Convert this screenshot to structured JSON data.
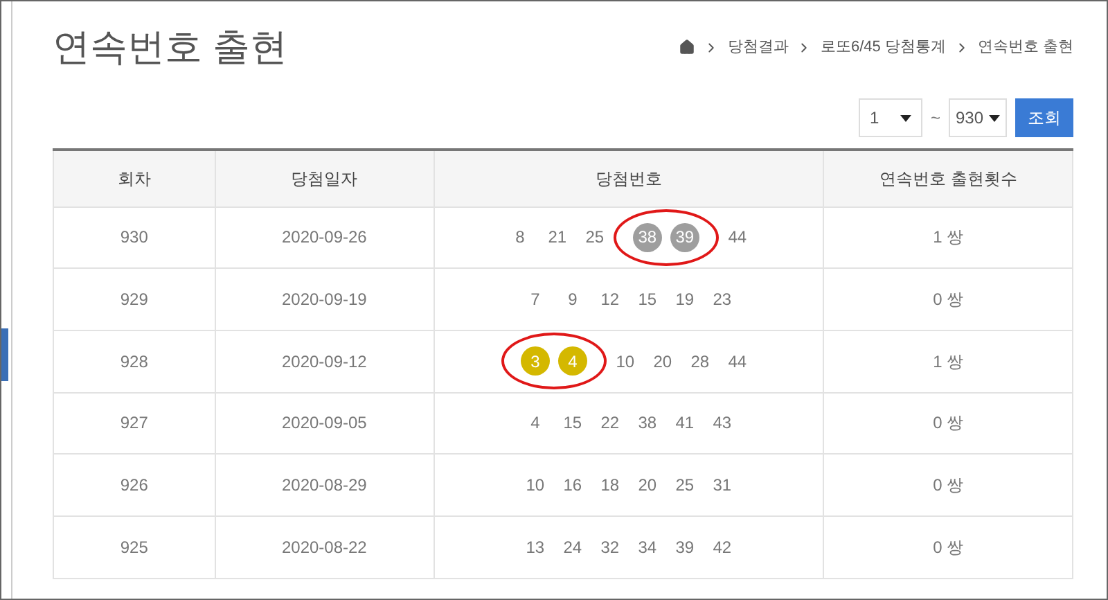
{
  "title": "연속번호 출현",
  "breadcrumb": [
    "당첨결과",
    "로또6/45 당첨통계",
    "연속번호 출현"
  ],
  "range": {
    "from": "1",
    "tilde": "~",
    "to": "930",
    "button": "조회"
  },
  "table": {
    "columns": [
      "회차",
      "당첨일자",
      "당첨번호",
      "연속번호 출현횟수"
    ],
    "rows": [
      {
        "round": "930",
        "date": "2020-09-26",
        "numbers": [
          {
            "n": "8",
            "ball": false
          },
          {
            "n": "21",
            "ball": false
          },
          {
            "n": "25",
            "ball": false
          },
          {
            "n": "38",
            "ball": true,
            "color": "#9e9e9e",
            "circled": true
          },
          {
            "n": "39",
            "ball": true,
            "color": "#9e9e9e",
            "circled": true
          },
          {
            "n": "44",
            "ball": false
          }
        ],
        "count": "1 쌍"
      },
      {
        "round": "929",
        "date": "2020-09-19",
        "numbers": [
          {
            "n": "7",
            "ball": false
          },
          {
            "n": "9",
            "ball": false
          },
          {
            "n": "12",
            "ball": false
          },
          {
            "n": "15",
            "ball": false
          },
          {
            "n": "19",
            "ball": false
          },
          {
            "n": "23",
            "ball": false
          }
        ],
        "count": "0 쌍"
      },
      {
        "round": "928",
        "date": "2020-09-12",
        "numbers": [
          {
            "n": "3",
            "ball": true,
            "color": "#d4b800",
            "circled": true
          },
          {
            "n": "4",
            "ball": true,
            "color": "#d4b800",
            "circled": true
          },
          {
            "n": "10",
            "ball": false
          },
          {
            "n": "20",
            "ball": false
          },
          {
            "n": "28",
            "ball": false
          },
          {
            "n": "44",
            "ball": false
          }
        ],
        "count": "1 쌍"
      },
      {
        "round": "927",
        "date": "2020-09-05",
        "numbers": [
          {
            "n": "4",
            "ball": false
          },
          {
            "n": "15",
            "ball": false
          },
          {
            "n": "22",
            "ball": false
          },
          {
            "n": "38",
            "ball": false
          },
          {
            "n": "41",
            "ball": false
          },
          {
            "n": "43",
            "ball": false
          }
        ],
        "count": "0 쌍"
      },
      {
        "round": "926",
        "date": "2020-08-29",
        "numbers": [
          {
            "n": "10",
            "ball": false
          },
          {
            "n": "16",
            "ball": false
          },
          {
            "n": "18",
            "ball": false
          },
          {
            "n": "20",
            "ball": false
          },
          {
            "n": "25",
            "ball": false
          },
          {
            "n": "31",
            "ball": false
          }
        ],
        "count": "0 쌍"
      },
      {
        "round": "925",
        "date": "2020-08-22",
        "numbers": [
          {
            "n": "13",
            "ball": false
          },
          {
            "n": "24",
            "ball": false
          },
          {
            "n": "32",
            "ball": false
          },
          {
            "n": "34",
            "ball": false
          },
          {
            "n": "39",
            "ball": false
          },
          {
            "n": "42",
            "ball": false
          }
        ],
        "count": "0 쌍"
      }
    ]
  }
}
